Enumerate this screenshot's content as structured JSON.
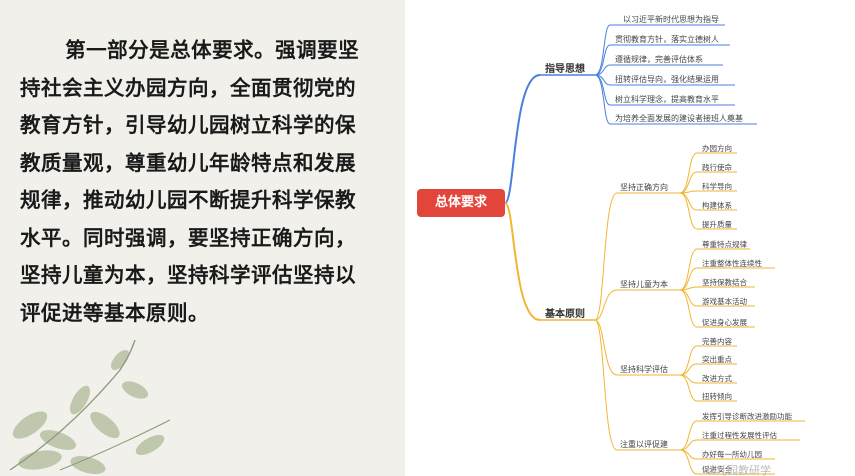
{
  "intro": {
    "text": "第一部分是总体要求。强调要坚持社会主义办园方向，全面贯彻党的教育方针，引导幼儿园树立科学的保教质量观，尊重幼儿年龄特点和发展规律，推动幼儿园不断提升科学保教水平。同时强调，要坚持正确方向，坚持儿童为本，坚持科学评估坚持以评促进等基本原则。"
  },
  "mindmap": {
    "root": "总体要求",
    "branches": [
      {
        "label": "指导思想",
        "color": "#4a7fe0",
        "items": [
          "以习近平新时代思想为指导",
          "贯彻教育方针，落实立德树人",
          "遵循规律，完善评估体系",
          "扭转评估导向，强化结果运用",
          "树立科学理念，提高教育水平",
          "为培养全面发展的建设者接班人奠基"
        ]
      },
      {
        "label": "基本原则",
        "color": "#f2b632",
        "groups": [
          {
            "label": "坚持正确方向",
            "items": [
              "办园方向",
              "践行使命",
              "科学导向",
              "构建体系",
              "提升质量"
            ]
          },
          {
            "label": "坚持儿童为本",
            "items": [
              "尊重特点规律",
              "注重整体性连续性",
              "坚持保教结合",
              "游戏基本活动",
              "促进身心发展"
            ]
          },
          {
            "label": "坚持科学评估",
            "items": [
              "完善内容",
              "突出重点",
              "改进方式",
              "扭转倾向"
            ]
          },
          {
            "label": "注重以评促建",
            "items": [
              "发挥引导诊断改进激励功能",
              "注重过程性发展性评估",
              "办好每一所幼儿园",
              "促进安全"
            ]
          }
        ]
      }
    ]
  },
  "watermark": "幼儿园教研学"
}
